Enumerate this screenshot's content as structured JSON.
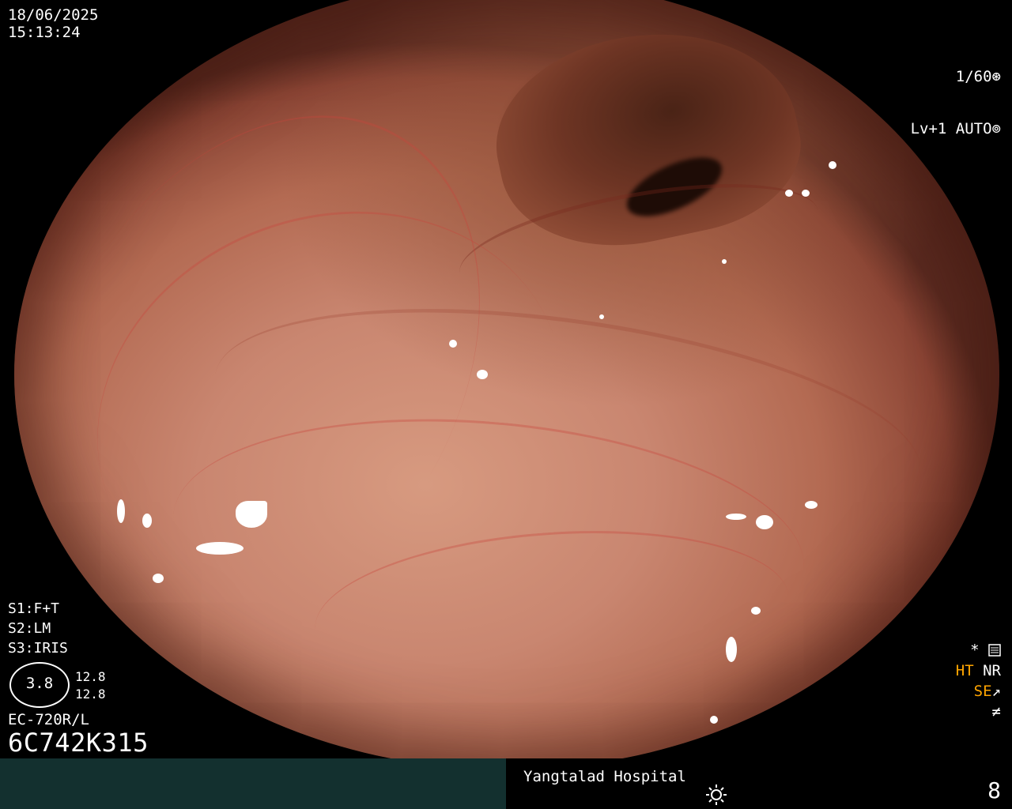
{
  "overlay": {
    "date": "18/06/2025",
    "time": "15:13:24",
    "shutter": "1/60",
    "level": "Lv+1",
    "iris_mode": "AUTO",
    "settings": [
      "S1:F+T",
      "S2:LM",
      "S3:IRIS"
    ],
    "gauge_value": "3.8",
    "gauge_readouts": [
      "12.8",
      "12.8"
    ],
    "scope_model": "EC-720R/L",
    "serial": "6C742K315",
    "status": {
      "star": "*",
      "ht": "HT",
      "nr": "NR",
      "se": "SE"
    }
  },
  "footer": {
    "hospital": "Yangtalad Hospital",
    "page_number": "8",
    "left_bar_color": "#13302f"
  },
  "icons": {
    "shutter": "aperture-icon",
    "auto": "iris-icon",
    "settings": "settings-sliders-icon",
    "se": "enhancement-curve-icon",
    "freeze": "freeze-icon",
    "brightness": "sun-icon"
  }
}
